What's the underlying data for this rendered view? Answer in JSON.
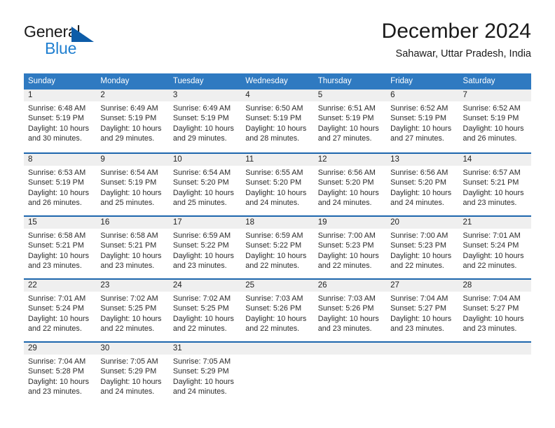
{
  "logo": {
    "word_one": "General",
    "word_two": "Blue",
    "triangle_color": "#0d5ca8",
    "blue_text_color": "#1f7fd0"
  },
  "header": {
    "month_title": "December 2024",
    "location": "Sahawar, Uttar Pradesh, India"
  },
  "colors": {
    "header_bar": "#2f7ac1",
    "row_divider": "#1d66ad",
    "day_band": "#efefef"
  },
  "weekdays": [
    "Sunday",
    "Monday",
    "Tuesday",
    "Wednesday",
    "Thursday",
    "Friday",
    "Saturday"
  ],
  "weeks": [
    [
      {
        "day": "1",
        "sunrise": "Sunrise: 6:48 AM",
        "sunset": "Sunset: 5:19 PM",
        "daylight_line1": "Daylight: 10 hours",
        "daylight_line2": "and 30 minutes."
      },
      {
        "day": "2",
        "sunrise": "Sunrise: 6:49 AM",
        "sunset": "Sunset: 5:19 PM",
        "daylight_line1": "Daylight: 10 hours",
        "daylight_line2": "and 29 minutes."
      },
      {
        "day": "3",
        "sunrise": "Sunrise: 6:49 AM",
        "sunset": "Sunset: 5:19 PM",
        "daylight_line1": "Daylight: 10 hours",
        "daylight_line2": "and 29 minutes."
      },
      {
        "day": "4",
        "sunrise": "Sunrise: 6:50 AM",
        "sunset": "Sunset: 5:19 PM",
        "daylight_line1": "Daylight: 10 hours",
        "daylight_line2": "and 28 minutes."
      },
      {
        "day": "5",
        "sunrise": "Sunrise: 6:51 AM",
        "sunset": "Sunset: 5:19 PM",
        "daylight_line1": "Daylight: 10 hours",
        "daylight_line2": "and 27 minutes."
      },
      {
        "day": "6",
        "sunrise": "Sunrise: 6:52 AM",
        "sunset": "Sunset: 5:19 PM",
        "daylight_line1": "Daylight: 10 hours",
        "daylight_line2": "and 27 minutes."
      },
      {
        "day": "7",
        "sunrise": "Sunrise: 6:52 AM",
        "sunset": "Sunset: 5:19 PM",
        "daylight_line1": "Daylight: 10 hours",
        "daylight_line2": "and 26 minutes."
      }
    ],
    [
      {
        "day": "8",
        "sunrise": "Sunrise: 6:53 AM",
        "sunset": "Sunset: 5:19 PM",
        "daylight_line1": "Daylight: 10 hours",
        "daylight_line2": "and 26 minutes."
      },
      {
        "day": "9",
        "sunrise": "Sunrise: 6:54 AM",
        "sunset": "Sunset: 5:19 PM",
        "daylight_line1": "Daylight: 10 hours",
        "daylight_line2": "and 25 minutes."
      },
      {
        "day": "10",
        "sunrise": "Sunrise: 6:54 AM",
        "sunset": "Sunset: 5:20 PM",
        "daylight_line1": "Daylight: 10 hours",
        "daylight_line2": "and 25 minutes."
      },
      {
        "day": "11",
        "sunrise": "Sunrise: 6:55 AM",
        "sunset": "Sunset: 5:20 PM",
        "daylight_line1": "Daylight: 10 hours",
        "daylight_line2": "and 24 minutes."
      },
      {
        "day": "12",
        "sunrise": "Sunrise: 6:56 AM",
        "sunset": "Sunset: 5:20 PM",
        "daylight_line1": "Daylight: 10 hours",
        "daylight_line2": "and 24 minutes."
      },
      {
        "day": "13",
        "sunrise": "Sunrise: 6:56 AM",
        "sunset": "Sunset: 5:20 PM",
        "daylight_line1": "Daylight: 10 hours",
        "daylight_line2": "and 24 minutes."
      },
      {
        "day": "14",
        "sunrise": "Sunrise: 6:57 AM",
        "sunset": "Sunset: 5:21 PM",
        "daylight_line1": "Daylight: 10 hours",
        "daylight_line2": "and 23 minutes."
      }
    ],
    [
      {
        "day": "15",
        "sunrise": "Sunrise: 6:58 AM",
        "sunset": "Sunset: 5:21 PM",
        "daylight_line1": "Daylight: 10 hours",
        "daylight_line2": "and 23 minutes."
      },
      {
        "day": "16",
        "sunrise": "Sunrise: 6:58 AM",
        "sunset": "Sunset: 5:21 PM",
        "daylight_line1": "Daylight: 10 hours",
        "daylight_line2": "and 23 minutes."
      },
      {
        "day": "17",
        "sunrise": "Sunrise: 6:59 AM",
        "sunset": "Sunset: 5:22 PM",
        "daylight_line1": "Daylight: 10 hours",
        "daylight_line2": "and 23 minutes."
      },
      {
        "day": "18",
        "sunrise": "Sunrise: 6:59 AM",
        "sunset": "Sunset: 5:22 PM",
        "daylight_line1": "Daylight: 10 hours",
        "daylight_line2": "and 22 minutes."
      },
      {
        "day": "19",
        "sunrise": "Sunrise: 7:00 AM",
        "sunset": "Sunset: 5:23 PM",
        "daylight_line1": "Daylight: 10 hours",
        "daylight_line2": "and 22 minutes."
      },
      {
        "day": "20",
        "sunrise": "Sunrise: 7:00 AM",
        "sunset": "Sunset: 5:23 PM",
        "daylight_line1": "Daylight: 10 hours",
        "daylight_line2": "and 22 minutes."
      },
      {
        "day": "21",
        "sunrise": "Sunrise: 7:01 AM",
        "sunset": "Sunset: 5:24 PM",
        "daylight_line1": "Daylight: 10 hours",
        "daylight_line2": "and 22 minutes."
      }
    ],
    [
      {
        "day": "22",
        "sunrise": "Sunrise: 7:01 AM",
        "sunset": "Sunset: 5:24 PM",
        "daylight_line1": "Daylight: 10 hours",
        "daylight_line2": "and 22 minutes."
      },
      {
        "day": "23",
        "sunrise": "Sunrise: 7:02 AM",
        "sunset": "Sunset: 5:25 PM",
        "daylight_line1": "Daylight: 10 hours",
        "daylight_line2": "and 22 minutes."
      },
      {
        "day": "24",
        "sunrise": "Sunrise: 7:02 AM",
        "sunset": "Sunset: 5:25 PM",
        "daylight_line1": "Daylight: 10 hours",
        "daylight_line2": "and 22 minutes."
      },
      {
        "day": "25",
        "sunrise": "Sunrise: 7:03 AM",
        "sunset": "Sunset: 5:26 PM",
        "daylight_line1": "Daylight: 10 hours",
        "daylight_line2": "and 22 minutes."
      },
      {
        "day": "26",
        "sunrise": "Sunrise: 7:03 AM",
        "sunset": "Sunset: 5:26 PM",
        "daylight_line1": "Daylight: 10 hours",
        "daylight_line2": "and 23 minutes."
      },
      {
        "day": "27",
        "sunrise": "Sunrise: 7:04 AM",
        "sunset": "Sunset: 5:27 PM",
        "daylight_line1": "Daylight: 10 hours",
        "daylight_line2": "and 23 minutes."
      },
      {
        "day": "28",
        "sunrise": "Sunrise: 7:04 AM",
        "sunset": "Sunset: 5:27 PM",
        "daylight_line1": "Daylight: 10 hours",
        "daylight_line2": "and 23 minutes."
      }
    ],
    [
      {
        "day": "29",
        "sunrise": "Sunrise: 7:04 AM",
        "sunset": "Sunset: 5:28 PM",
        "daylight_line1": "Daylight: 10 hours",
        "daylight_line2": "and 23 minutes."
      },
      {
        "day": "30",
        "sunrise": "Sunrise: 7:05 AM",
        "sunset": "Sunset: 5:29 PM",
        "daylight_line1": "Daylight: 10 hours",
        "daylight_line2": "and 24 minutes."
      },
      {
        "day": "31",
        "sunrise": "Sunrise: 7:05 AM",
        "sunset": "Sunset: 5:29 PM",
        "daylight_line1": "Daylight: 10 hours",
        "daylight_line2": "and 24 minutes."
      },
      {
        "day": "",
        "sunrise": "",
        "sunset": "",
        "daylight_line1": "",
        "daylight_line2": ""
      },
      {
        "day": "",
        "sunrise": "",
        "sunset": "",
        "daylight_line1": "",
        "daylight_line2": ""
      },
      {
        "day": "",
        "sunrise": "",
        "sunset": "",
        "daylight_line1": "",
        "daylight_line2": ""
      },
      {
        "day": "",
        "sunrise": "",
        "sunset": "",
        "daylight_line1": "",
        "daylight_line2": ""
      }
    ]
  ]
}
